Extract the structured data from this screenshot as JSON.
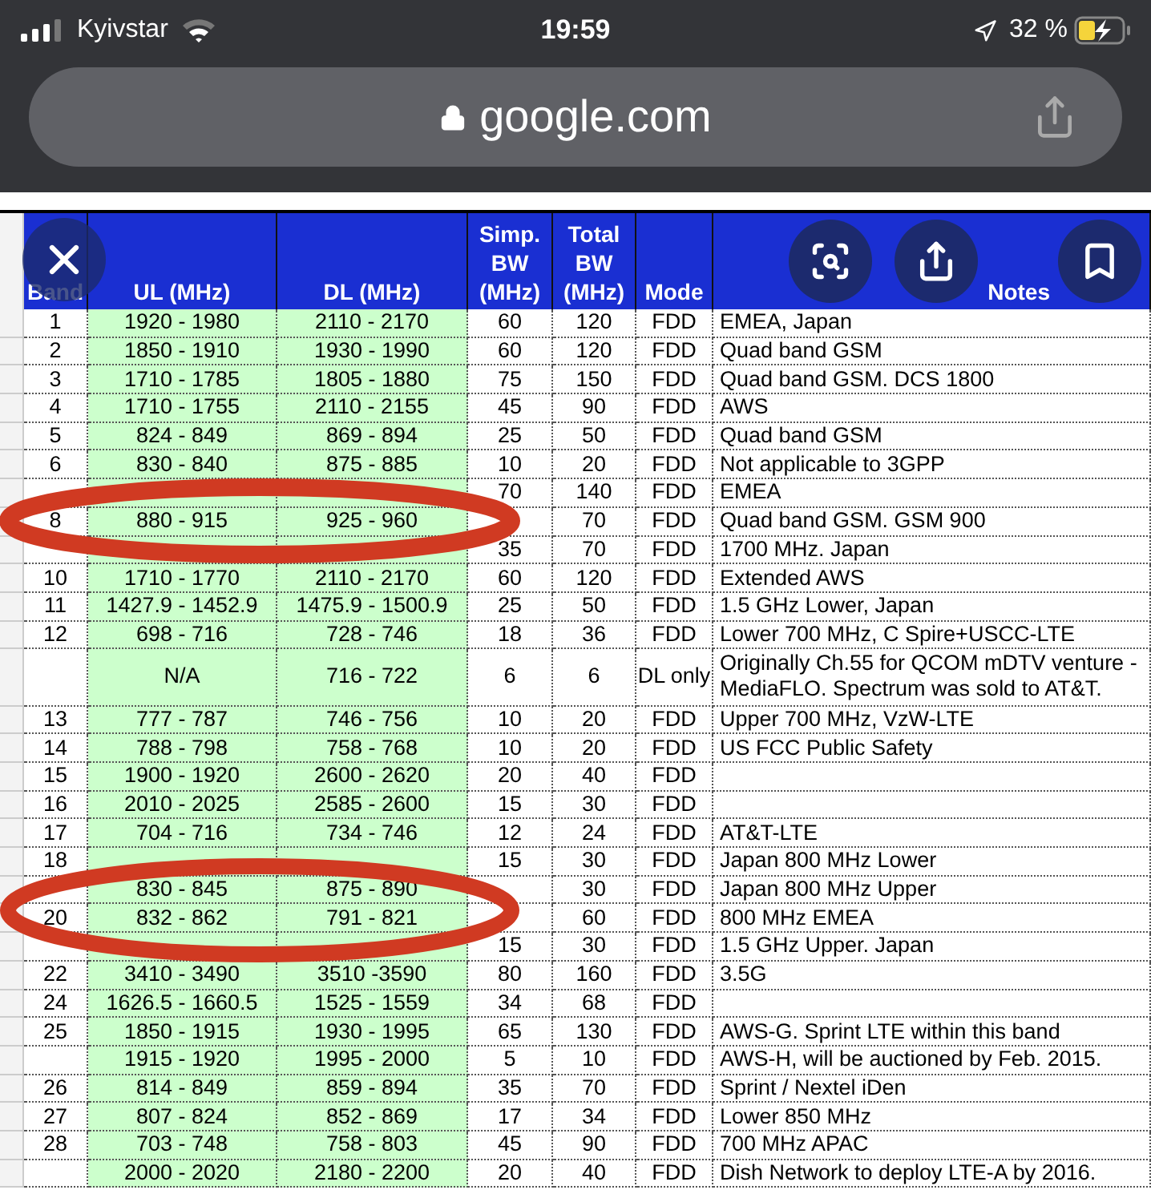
{
  "status_bar": {
    "carrier": "Kyivstar",
    "time": "19:59",
    "battery": "32 %"
  },
  "address_bar": {
    "url": "google.com"
  },
  "table": {
    "columns": [
      "Band",
      "UL (MHz)",
      "DL (MHz)",
      "Simp. BW (MHz)",
      "Total BW (MHz)",
      "Mode",
      "Notes"
    ],
    "rows": [
      {
        "band": "1",
        "ul": "1920 - 1980",
        "dl": "2110 - 2170",
        "simp": "60",
        "total": "120",
        "mode": "FDD",
        "notes": "EMEA, Japan"
      },
      {
        "band": "2",
        "ul": "1850 - 1910",
        "dl": "1930 - 1990",
        "simp": "60",
        "total": "120",
        "mode": "FDD",
        "notes": "Quad band GSM"
      },
      {
        "band": "3",
        "ul": "1710 - 1785",
        "dl": "1805 - 1880",
        "simp": "75",
        "total": "150",
        "mode": "FDD",
        "notes": "Quad band GSM. DCS 1800"
      },
      {
        "band": "4",
        "ul": "1710 - 1755",
        "dl": "2110 - 2155",
        "simp": "45",
        "total": "90",
        "mode": "FDD",
        "notes": "AWS"
      },
      {
        "band": "5",
        "ul": "824 - 849",
        "dl": "869 - 894",
        "simp": "25",
        "total": "50",
        "mode": "FDD",
        "notes": "Quad band GSM"
      },
      {
        "band": "6",
        "ul": "830 - 840",
        "dl": "875 - 885",
        "simp": "10",
        "total": "20",
        "mode": "FDD",
        "notes": "Not applicable to 3GPP"
      },
      {
        "simp": "70",
        "total": "140",
        "mode": "FDD",
        "notes": "EMEA"
      },
      {
        "band": "8",
        "ul": "880 - 915",
        "dl": "925 - 960",
        "total": "70",
        "mode": "FDD",
        "notes": "Quad band GSM. GSM 900"
      },
      {
        "simp": "35",
        "total": "70",
        "mode": "FDD",
        "notes": "1700 MHz. Japan"
      },
      {
        "band": "10",
        "ul": "1710 - 1770",
        "dl": "2110 - 2170",
        "simp": "60",
        "total": "120",
        "mode": "FDD",
        "notes": "Extended AWS"
      },
      {
        "band": "11",
        "ul": "1427.9 - 1452.9",
        "dl": "1475.9 - 1500.9",
        "simp": "25",
        "total": "50",
        "mode": "FDD",
        "notes": "1.5 GHz Lower, Japan"
      },
      {
        "band": "12",
        "ul": "698 - 716",
        "dl": "728 - 746",
        "simp": "18",
        "total": "36",
        "mode": "FDD",
        "notes": "Lower 700 MHz, C Spire+USCC-LTE"
      },
      {
        "kind": "double",
        "ul": "N/A",
        "dl": "716 - 722",
        "simp": "6",
        "total": "6",
        "mode": "DL only",
        "notes": "Originally Ch.55 for QCOM mDTV venture - MediaFLO.  Spectrum was sold to AT&T."
      },
      {
        "band": "13",
        "ul": "777 - 787",
        "dl": "746 - 756",
        "simp": "10",
        "total": "20",
        "mode": "FDD",
        "notes": "Upper 700 MHz, VzW-LTE"
      },
      {
        "band": "14",
        "ul": "788 - 798",
        "dl": "758 - 768",
        "simp": "10",
        "total": "20",
        "mode": "FDD",
        "notes": "US FCC Public Safety"
      },
      {
        "band": "15",
        "ul": "1900 - 1920",
        "dl": "2600 - 2620",
        "simp": "20",
        "total": "40",
        "mode": "FDD"
      },
      {
        "band": "16",
        "ul": "2010 - 2025",
        "dl": "2585 - 2600",
        "simp": "15",
        "total": "30",
        "mode": "FDD"
      },
      {
        "band": "17",
        "ul": "704 - 716",
        "dl": "734 - 746",
        "simp": "12",
        "total": "24",
        "mode": "FDD",
        "notes": "AT&T-LTE"
      },
      {
        "band": "18",
        "simp": "15",
        "total": "30",
        "mode": "FDD",
        "notes": "Japan 800 MHz Lower"
      },
      {
        "ul": "830 - 845",
        "dl": "875 - 890",
        "total": "30",
        "mode": "FDD",
        "notes": "Japan 800 MHz Upper"
      },
      {
        "band": "20",
        "ul": "832 - 862",
        "dl": "791 - 821",
        "total": "60",
        "mode": "FDD",
        "notes": "800 MHz EMEA"
      },
      {
        "simp": "15",
        "total": "30",
        "mode": "FDD",
        "notes": "1.5 GHz Upper. Japan"
      },
      {
        "band": "22",
        "ul": "3410 - 3490",
        "dl": "3510 -3590",
        "simp": "80",
        "total": "160",
        "mode": "FDD",
        "notes": "3.5G"
      },
      {
        "band": "24",
        "ul": "1626.5 - 1660.5",
        "dl": "1525 - 1559",
        "simp": "34",
        "total": "68",
        "mode": "FDD"
      },
      {
        "band": "25",
        "ul": "1850 - 1915",
        "dl": "1930 - 1995",
        "simp": "65",
        "total": "130",
        "mode": "FDD",
        "notes": "AWS-G. Sprint LTE within this band"
      },
      {
        "ul": "1915 - 1920",
        "dl": "1995 - 2000",
        "simp": "5",
        "total": "10",
        "mode": "FDD",
        "notes": "AWS-H, will be auctioned by Feb. 2015."
      },
      {
        "band": "26",
        "ul": "814 - 849",
        "dl": "859 - 894",
        "simp": "35",
        "total": "70",
        "mode": "FDD",
        "notes": "Sprint / Nextel iDen"
      },
      {
        "band": "27",
        "ul": "807 - 824",
        "dl": "852 - 869",
        "simp": "17",
        "total": "34",
        "mode": "FDD",
        "notes": "Lower 850 MHz"
      },
      {
        "band": "28",
        "ul": "703 - 748",
        "dl": "758 - 803",
        "simp": "45",
        "total": "90",
        "mode": "FDD",
        "notes": "700 MHz APAC"
      },
      {
        "ul": "2000 - 2020",
        "dl": "2180 - 2200",
        "simp": "20",
        "total": "40",
        "mode": "FDD",
        "notes": "Dish Network to deploy LTE-A by 2016."
      }
    ]
  }
}
